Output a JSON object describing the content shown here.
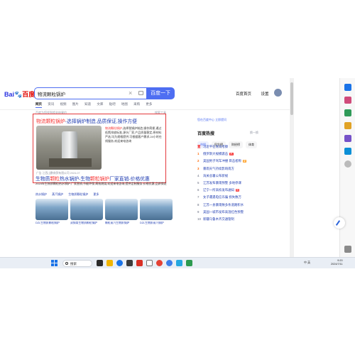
{
  "search": {
    "logo_bai": "Bai",
    "logo_du": "百度",
    "query": "物流颗粒锅炉",
    "button_label": "百度一下"
  },
  "top_links": [
    "百度首页",
    "设置"
  ],
  "tabs": [
    "网页",
    "资讯",
    "视频",
    "图片",
    "知道",
    "文库",
    "贴吧",
    "地图",
    "采购",
    "更多"
  ],
  "result_count": "百度为您找到相关结果约",
  "tools_label": "搜索工具",
  "results": [
    {
      "title_em": "物流颗粒锅炉",
      "title_rest": "-选择锅炉制造,品质保证,操作方便",
      "desc_pre": "",
      "desc_em": "物流颗粒锅炉",
      "desc_rest": ",选择我锅炉制造,操作简便,通过低氮排放标准,源头厂家,产品质量稳定,原材料严选,均为规格提供,可根据客户需求,24小时在线服务,欢迎来电咨询",
      "ad": "广告 江西山鹏商贸有限公司 2024-07"
    },
    {
      "title_pre": "生物质",
      "title_em1": "颗粒",
      "title_mid": "热水锅炉-生物",
      "title_em2": "颗粒锅炉",
      "title_rest": "厂家直销-价格优惠",
      "snippet": "2023年生物质颗粒热水锅炉,厂家直销,节能环保,高效燃烧,欢迎来电咨询,提供定制服务,价格优惠,品质保证",
      "links": [
        "热水锅炉",
        "蒸汽锅炉",
        "生物质颗粒锅炉",
        "更多"
      ],
      "cards": [
        "DZL生物质颗粒锅炉",
        "双锅筒生物质颗粒锅炉",
        "颗粒蒸汽生物质锅炉",
        "DZL生物质蒸汽锅炉"
      ]
    }
  ],
  "hot": {
    "recommend": "您在百度中心 立即提问",
    "title": "百度热搜",
    "refresh": "换一换",
    "tabs": [
      "热搜",
      "民生榜",
      "财经榜",
      "体育"
    ],
    "items": [
      {
        "idx": "置",
        "text": "习近平在青海考察",
        "tag": ""
      },
      {
        "idx": "1",
        "text": "俄罗斯大规模袭击",
        "tag": "热"
      },
      {
        "idx": "2",
        "text": "美国男子驾车冲撞 目击者称",
        "tag": "新"
      },
      {
        "idx": "3",
        "text": "暴雨天气持续影响南方",
        "tag": ""
      },
      {
        "idx": "4",
        "text": "海关总署公布新规",
        "tag": ""
      },
      {
        "idx": "5",
        "text": "江苏发布暴雨预警 多地停课",
        "tag": ""
      },
      {
        "idx": "6",
        "text": "辽宁一所高校发布通知",
        "tag": "热"
      },
      {
        "idx": "7",
        "text": "女子遭遇电信诈骗 损失数万",
        "tag": ""
      },
      {
        "idx": "8",
        "text": "江苏一县暴雨致多条道路积水",
        "tag": ""
      },
      {
        "idx": "9",
        "text": "美国一城市发布高温红色预警",
        "tag": ""
      },
      {
        "idx": "10",
        "text": "新疆乌鲁木齐交通管制",
        "tag": ""
      }
    ]
  },
  "taskbar": {
    "search_placeholder": "搜索",
    "tray_text": "中 英",
    "time": "9:20",
    "date": "2024/7/11"
  },
  "colors": {
    "brand_blue": "#4e6ef2",
    "link_blue": "#2440b3",
    "highlight_red": "#e4393c",
    "em_red": "#f73131"
  }
}
